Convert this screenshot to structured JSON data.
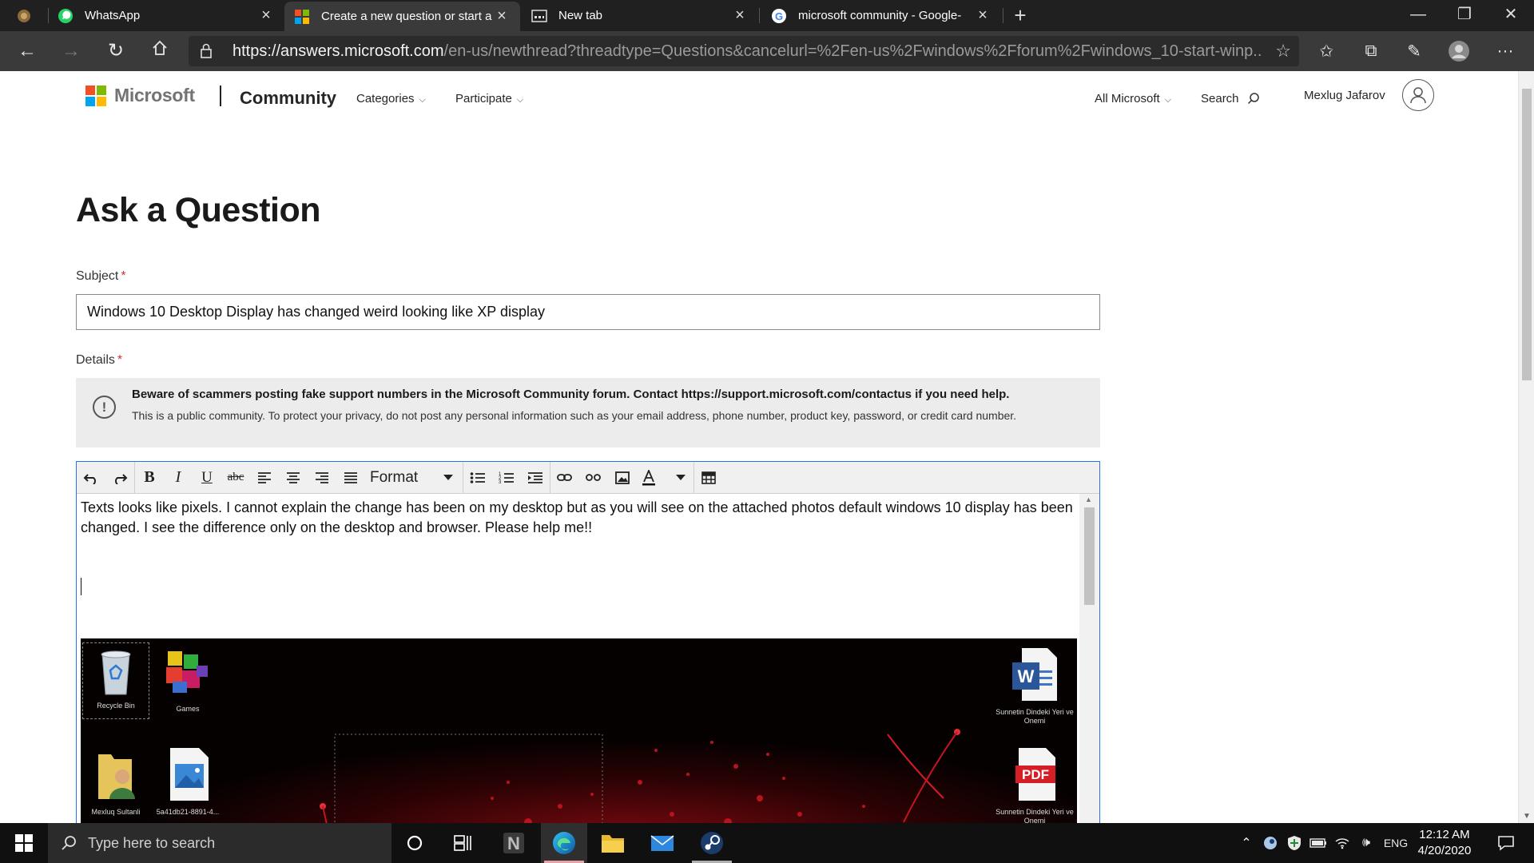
{
  "browser": {
    "tabs": [
      {
        "title": "",
        "icon": "pinned-tab-icon"
      },
      {
        "title": "WhatsApp",
        "icon": "whatsapp-icon"
      },
      {
        "title": "Create a new question or start a d",
        "icon": "microsoft-icon"
      },
      {
        "title": "New tab",
        "icon": "new-tab-icon"
      },
      {
        "title": "microsoft community - Google-",
        "icon": "google-icon"
      }
    ],
    "address_host": "https://answers.microsoft.com",
    "address_path": "/en-us/newthread?threadtype=Questions&cancelurl=%2Fen-us%2Fwindows%2Fforum%2Fwindows_10-start-winp...",
    "colors": {
      "chrome_dark": "#202020",
      "toolbar": "#3a3a3a"
    }
  },
  "header": {
    "brand": "Microsoft",
    "site": "Community",
    "nav": [
      "Categories",
      "Participate"
    ],
    "all_microsoft": "All Microsoft",
    "search": "Search",
    "user": "Mexlug Jafarov"
  },
  "form": {
    "title": "Ask a Question",
    "subject_label": "Subject",
    "required_mark": "*",
    "subject_value": "Windows 10 Desktop Display has changed weird looking like XP display",
    "details_label": "Details",
    "notice_title": "Beware of scammers posting fake support numbers in the Microsoft Community forum. Contact https://support.microsoft.com/contactus if you need help.",
    "notice_body": "This is a public community. To protect your privacy, do not post any personal information such as your email address, phone number, product key, password, or credit card number.",
    "format_label": "Format",
    "editor_text": "Texts looks like pixels. I cannot explain the change has been on my desktop but as you will see on the attached photos default windows 10 display has been changed.  I see the difference only on the desktop and browser. Please help me!!",
    "attachment_icons": [
      {
        "label": "Recycle Bin"
      },
      {
        "label": "Games"
      },
      {
        "label": "Sunnetin Dindeki Yeri ve Onemi"
      },
      {
        "label": "Mexluq Sultanli"
      },
      {
        "label": "5a41db21-8891-4..."
      },
      {
        "label": "Sunnetin Dindeki Yeri ve Onemi"
      }
    ],
    "pdf_badge": "PDF",
    "word_badge": "W"
  },
  "taskbar": {
    "search_placeholder": "Type here to search",
    "language": "ENG",
    "time": "12:12 AM",
    "date": "4/20/2020"
  }
}
